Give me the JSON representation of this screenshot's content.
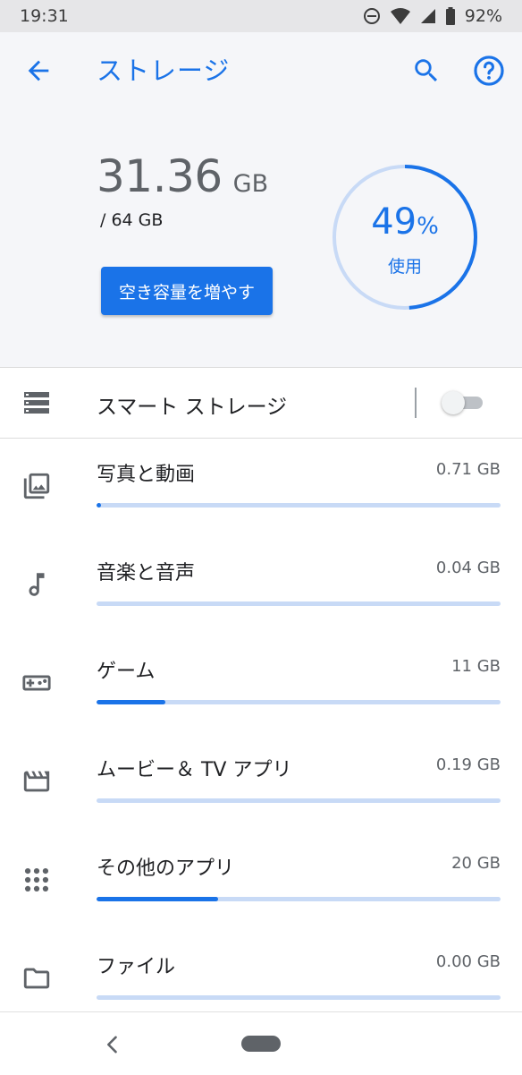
{
  "status_bar": {
    "time": "19:31",
    "battery": "92%",
    "icons": [
      "do-not-disturb-icon",
      "wifi-icon",
      "cell-signal-icon",
      "battery-icon"
    ]
  },
  "app_bar": {
    "title": "ストレージ",
    "back_icon": "arrow-back-icon",
    "search_icon": "search-icon",
    "help_icon": "help-icon"
  },
  "summary": {
    "used_value": "31.36",
    "used_unit": "GB",
    "total": "/ 64 GB",
    "free_up_button": "空き容量を増やす",
    "percent_value": "49",
    "percent_sign": "%",
    "percent_label": "使用",
    "percent_used": 49
  },
  "smart_storage": {
    "label": "スマート ストレージ",
    "icon": "storage-list-icon",
    "enabled": false
  },
  "categories": [
    {
      "label": "写真と動画",
      "size": "0.71 GB",
      "icon": "photo-library-icon",
      "fraction": 0.011
    },
    {
      "label": "音楽と音声",
      "size": "0.04 GB",
      "icon": "music-note-icon",
      "fraction": 0.0
    },
    {
      "label": "ゲーム",
      "size": "11 GB",
      "icon": "gamepad-icon",
      "fraction": 0.17
    },
    {
      "label": "ムービー＆ TV アプリ",
      "size": "0.19 GB",
      "icon": "movie-icon",
      "fraction": 0.0
    },
    {
      "label": "その他のアプリ",
      "size": "20 GB",
      "icon": "apps-grid-icon",
      "fraction": 0.3
    },
    {
      "label": "ファイル",
      "size": "0.00 GB",
      "icon": "folder-icon",
      "fraction": 0.0
    }
  ],
  "colors": {
    "accent": "#1a73e8",
    "track": "#c8daf6",
    "header_bg": "#f5f6f9"
  }
}
